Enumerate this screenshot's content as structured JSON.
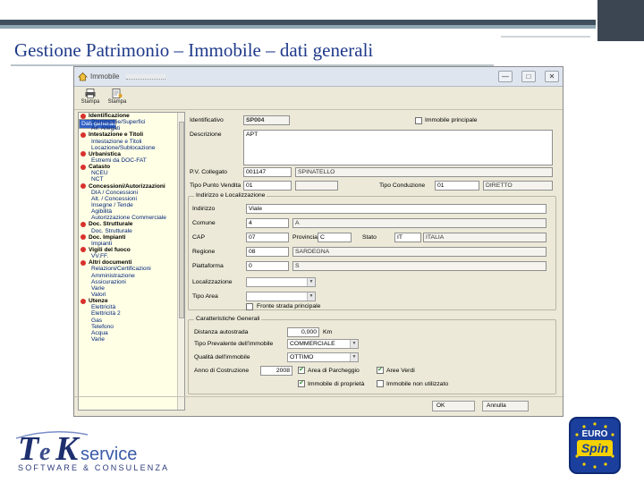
{
  "slide": {
    "title": "Gestione Patrimonio – Immobile – dati generali"
  },
  "window": {
    "title": "Immobile",
    "controls": {
      "minimize": "—",
      "maximize": "□",
      "close": "✕"
    }
  },
  "toolbar": {
    "print_label": "Stampa",
    "print2_label": "Stampa"
  },
  "tree": {
    "items": [
      {
        "type": "group",
        "label": "Identificazione"
      },
      {
        "type": "child",
        "label": "Dati generali",
        "selected": true
      },
      {
        "type": "child",
        "label": "Planimetrie/Superfici"
      },
      {
        "type": "child",
        "label": "All. Allegati"
      },
      {
        "type": "group",
        "label": "Intestazione e Titoli"
      },
      {
        "type": "child",
        "label": "Intestazione e Titoli"
      },
      {
        "type": "child",
        "label": "Locazione/Sublocazione"
      },
      {
        "type": "group",
        "label": "Urbanistica"
      },
      {
        "type": "child",
        "label": "Estremi da DOC-FAT"
      },
      {
        "type": "group",
        "label": "Catasto"
      },
      {
        "type": "child",
        "label": "NCEU"
      },
      {
        "type": "child",
        "label": "NCT"
      },
      {
        "type": "group",
        "label": "Concessioni/Autorizzazioni"
      },
      {
        "type": "child",
        "label": "DIA / Concessioni"
      },
      {
        "type": "child",
        "label": "Alt. / Concessioni"
      },
      {
        "type": "child",
        "label": "Insegne / Tende"
      },
      {
        "type": "child",
        "label": "Agibilità"
      },
      {
        "type": "child",
        "label": "Autorizzazione Commerciale"
      },
      {
        "type": "group",
        "label": "Doc. Strutturale"
      },
      {
        "type": "child",
        "label": "Doc. Strutturale"
      },
      {
        "type": "group",
        "label": "Doc. Impianti"
      },
      {
        "type": "child",
        "label": "Impianti"
      },
      {
        "type": "group",
        "label": "Vigili del fuoco"
      },
      {
        "type": "child",
        "label": "VV.FF."
      },
      {
        "type": "group",
        "label": "Altri documenti"
      },
      {
        "type": "child",
        "label": "Relazioni/Certificazioni"
      },
      {
        "type": "child",
        "label": "Amministrazione"
      },
      {
        "type": "child",
        "label": "Assicurazioni"
      },
      {
        "type": "child",
        "label": "Varie"
      },
      {
        "type": "child",
        "label": "Valori"
      },
      {
        "type": "group",
        "label": "Utenze"
      },
      {
        "type": "child",
        "label": "Elettricità"
      },
      {
        "type": "child",
        "label": "Elettricità 2"
      },
      {
        "type": "child",
        "label": "Gas"
      },
      {
        "type": "child",
        "label": "Telefono"
      },
      {
        "type": "child",
        "label": "Acqua"
      },
      {
        "type": "child",
        "label": "Varie"
      }
    ]
  },
  "form": {
    "identificativo": {
      "label": "Identificativo",
      "value": "SP004"
    },
    "immobile_principale": {
      "label": "Immobile principale"
    },
    "descrizione": {
      "label": "Descrizione",
      "value": "APT"
    },
    "pv_collegato": {
      "label": "P.V. Collegato",
      "value": "001147",
      "desc": "SPINATELLO"
    },
    "tipo_punto_vendita": {
      "label": "Tipo Punto Vendita",
      "value": "01"
    },
    "tipo_conduzione": {
      "label": "Tipo Conduzione",
      "value": "01",
      "desc": "DIRETTO"
    },
    "indirizzo_group": "Indirizzo e Localizzazione",
    "indirizzo": {
      "label": "Indirizzo",
      "value": "Viale"
    },
    "comune": {
      "label": "Comune",
      "value": "4",
      "desc": "A"
    },
    "cap": {
      "label": "CAP",
      "value": "07",
      "provincia_label": "Provincia",
      "provincia": "C",
      "stato_label": "Stato",
      "stato": "IT",
      "stato_desc": "ITALIA"
    },
    "regione": {
      "label": "Regione",
      "value": "08",
      "desc": "SARDEGNA"
    },
    "piattaforma": {
      "label": "Piattaforma",
      "value": "0",
      "desc": "S"
    },
    "localizzazione": {
      "label": "Localizzazione"
    },
    "tipo_area": {
      "label": "Tipo Area"
    },
    "fronte_strada": {
      "label": "Fronte strada principale"
    },
    "caratteristiche_group": "Caratteristiche Generali",
    "distanza_autostrada": {
      "label": "Distanza autostrada",
      "value": "0,000",
      "unit": "Km"
    },
    "tipo_prevalente": {
      "label": "Tipo Prevalente dell'immobile",
      "value": "COMMERCIALE"
    },
    "qualita_immobile": {
      "label": "Qualità dell'immobile",
      "value": "OTTIMO"
    },
    "anno_costruzione": {
      "label": "Anno di Costruzione",
      "value": "2008"
    },
    "area_parcheggio": {
      "label": "Area di Parcheggio",
      "checked": true
    },
    "aree_verdi": {
      "label": "Aree Verdi",
      "checked": true
    },
    "immobile_proprieta": {
      "label": "Immobile di proprietà",
      "checked": true
    },
    "immobile_non_utilizzato": {
      "label": "Immobile non utilizzato",
      "checked": false
    }
  },
  "statusbar": {
    "ok_label": "OK",
    "cancel_label": "Annulla"
  },
  "logos": {
    "tek_tagline": "SOFTWARE & CONSULENZA",
    "tek_brand": "service",
    "euro_top": "EURO",
    "euro_bottom": "Spin"
  },
  "colors": {
    "title": "#1f3a8a",
    "tree_bg": "#ffffe6",
    "selection": "#3162c5",
    "window_bg": "#ece9d8"
  }
}
